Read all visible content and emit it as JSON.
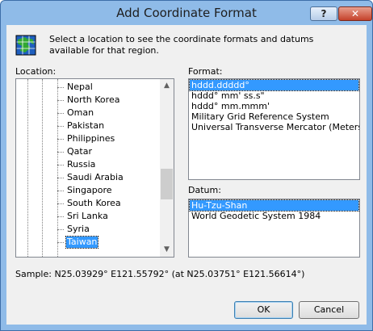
{
  "window": {
    "title": "Add Coordinate Format",
    "help_label": "?",
    "close_label": "✕"
  },
  "intro_text": "Select a location to see the coordinate formats and datums available for that region.",
  "location": {
    "label": "Location:",
    "items": [
      "Nepal",
      "North Korea",
      "Oman",
      "Pakistan",
      "Philippines",
      "Qatar",
      "Russia",
      "Saudi Arabia",
      "Singapore",
      "South Korea",
      "Sri Lanka",
      "Syria",
      "Taiwan"
    ],
    "selected": "Taiwan"
  },
  "format": {
    "label": "Format:",
    "items": [
      "hddd.ddddd°",
      "hddd° mm' ss.s\"",
      "hddd° mm.mmm'",
      "Military Grid Reference System",
      "Universal Transverse Mercator (Meters)"
    ],
    "selected": "hddd.ddddd°"
  },
  "datum": {
    "label": "Datum:",
    "items": [
      "Hu-Tzu-Shan",
      "World Geodetic System 1984"
    ],
    "selected": "Hu-Tzu-Shan"
  },
  "sample_text": "Sample: N25.03929° E121.55792° (at N25.03751° E121.56614°)",
  "buttons": {
    "ok": "OK",
    "cancel": "Cancel"
  },
  "icons": {
    "app": "globe-grid-icon",
    "scroll_up": "arrow-up-icon",
    "scroll_down": "arrow-down-icon"
  },
  "colors": {
    "selection": "#3399ff",
    "title_bar": "#8fbbe8",
    "close_button": "#c5412a"
  }
}
